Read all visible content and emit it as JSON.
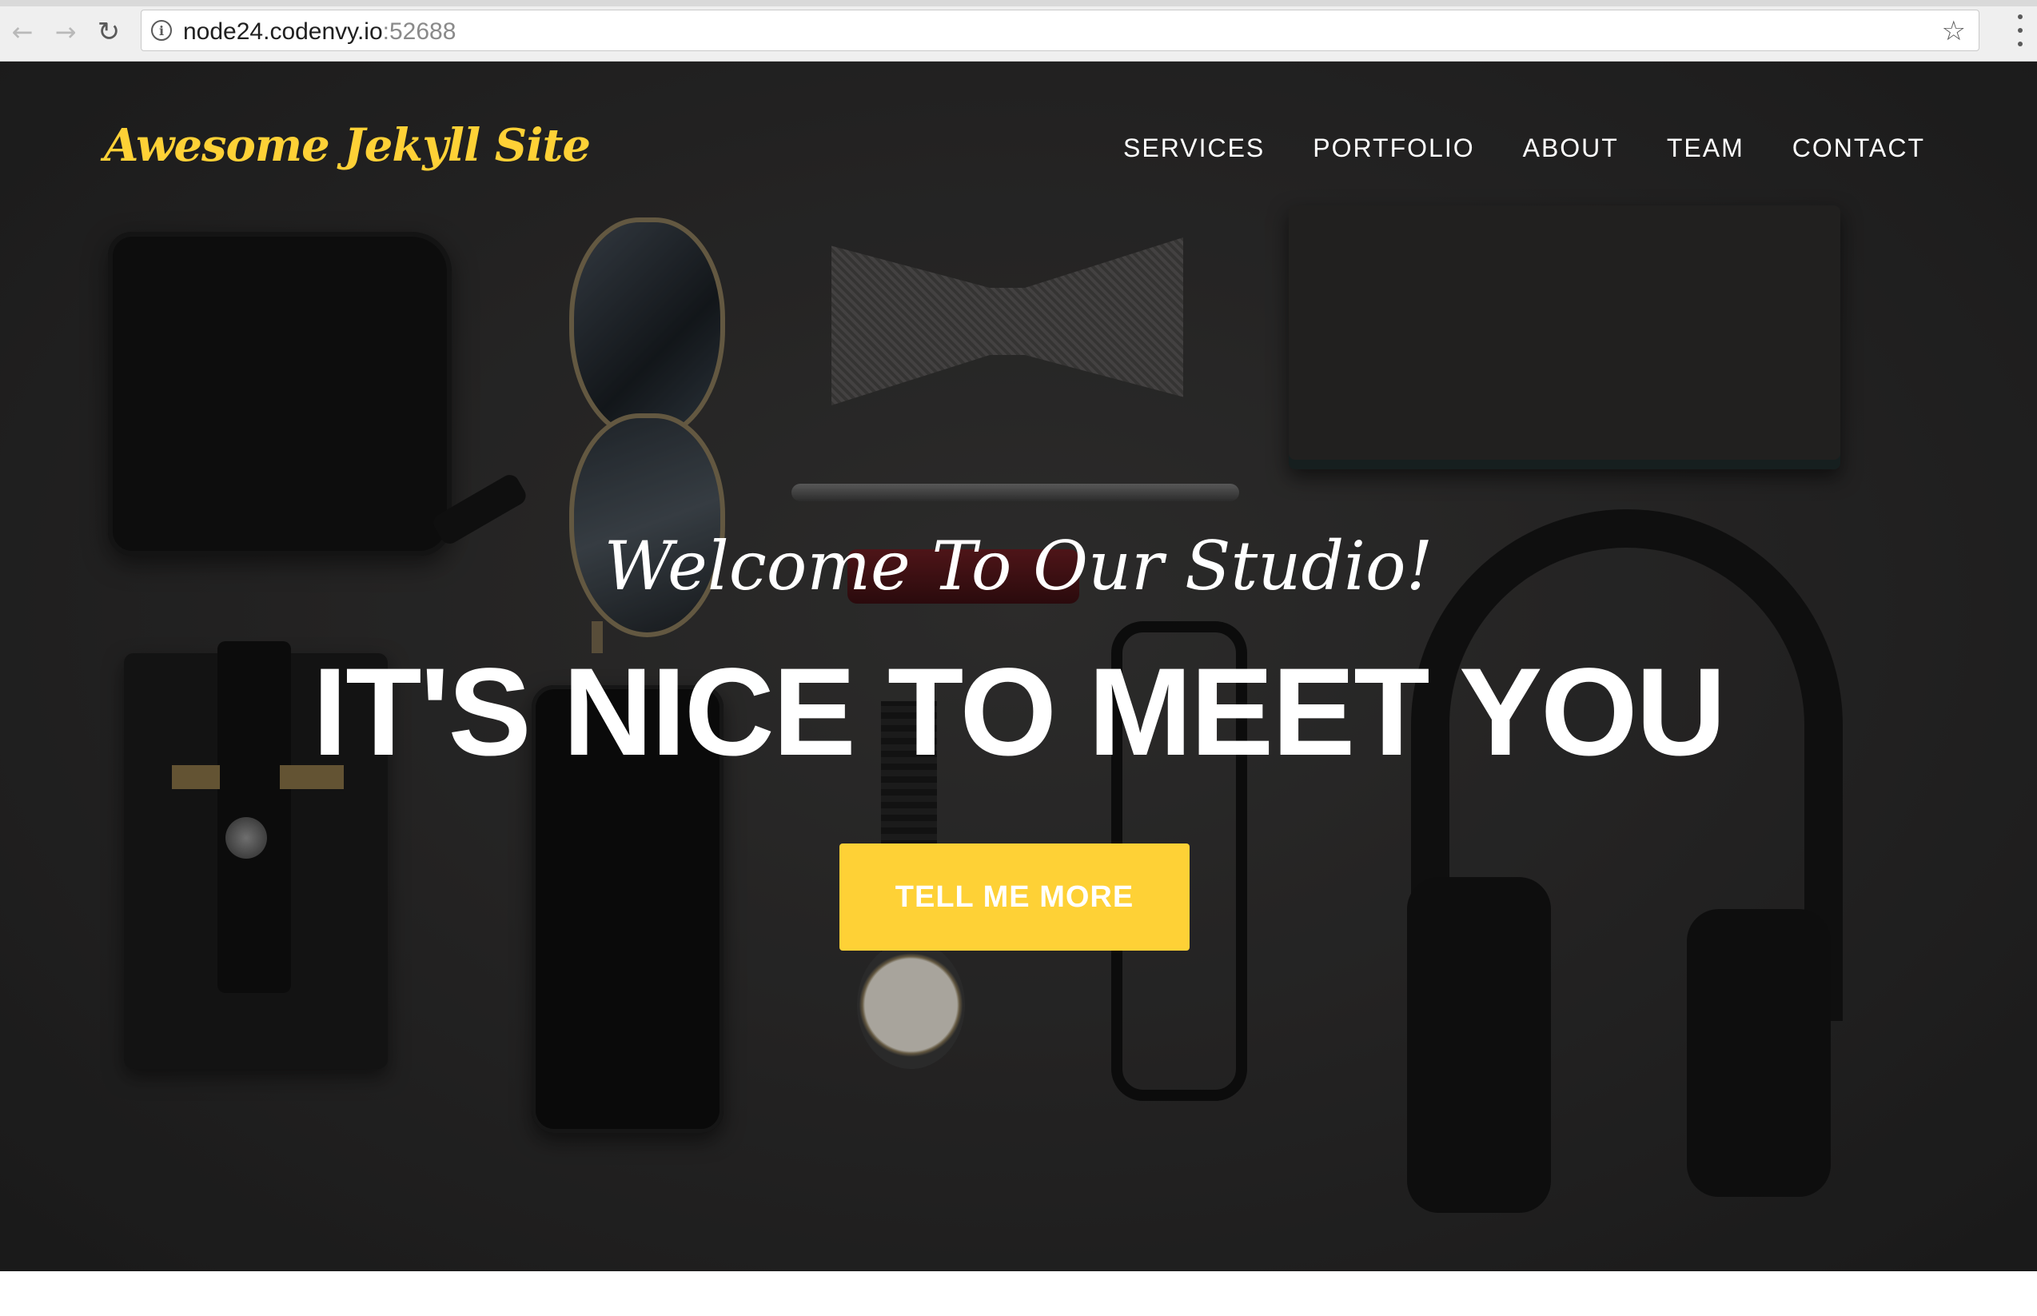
{
  "browser": {
    "back_icon": "arrow-left-icon",
    "forward_icon": "arrow-right-icon",
    "reload_icon": "reload-icon",
    "info_icon": "info-icon",
    "url_host": "node24.codenvy.io",
    "url_port": ":52688",
    "bookmark_icon": "star-icon",
    "menu_icon": "kebab-menu-icon"
  },
  "site": {
    "brand": "Awesome Jekyll Site",
    "nav": [
      {
        "label": "SERVICES"
      },
      {
        "label": "PORTFOLIO"
      },
      {
        "label": "ABOUT"
      },
      {
        "label": "TEAM"
      },
      {
        "label": "CONTACT"
      }
    ]
  },
  "hero": {
    "lead": "Welcome To Our Studio!",
    "heading": "IT'S NICE TO MEET YOU",
    "cta_label": "TELL ME MORE"
  },
  "colors": {
    "accent": "#fed136",
    "hero_text": "#ffffff",
    "hero_background": "#2e2d2c"
  }
}
